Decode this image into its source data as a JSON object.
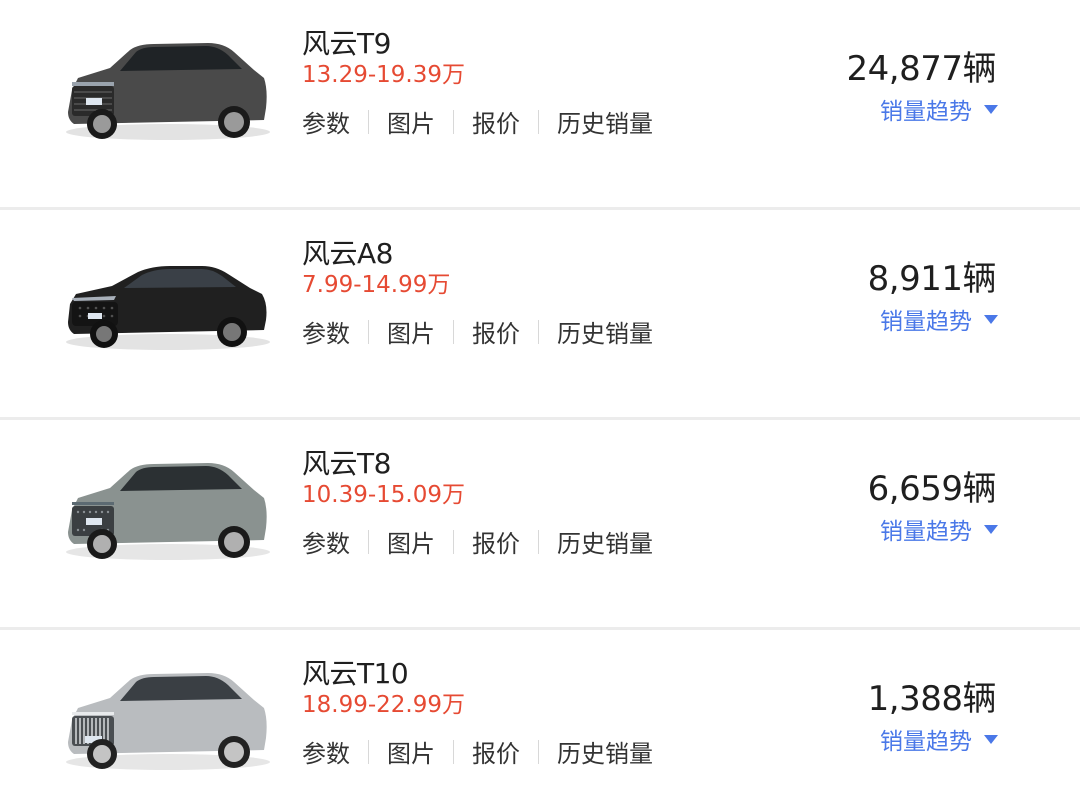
{
  "links": {
    "params": "参数",
    "photos": "图片",
    "quote": "报价",
    "history": "历史销量"
  },
  "trend_label": "销量趋势",
  "cars": [
    {
      "name": "风云T9",
      "price": "13.29-19.39万",
      "sales": "24,877辆",
      "body_color": "#4a4a4a",
      "type": "suv"
    },
    {
      "name": "风云A8",
      "price": "7.99-14.99万",
      "sales": "8,911辆",
      "body_color": "#202020",
      "type": "sedan"
    },
    {
      "name": "风云T8",
      "price": "10.39-15.09万",
      "sales": "6,659辆",
      "body_color": "#8a9290",
      "type": "suv"
    },
    {
      "name": "风云T10",
      "price": "18.99-22.99万",
      "sales": "1,388辆",
      "body_color": "#b9bcbf",
      "type": "suv"
    }
  ],
  "colors": {
    "price": "#e64a33",
    "trend": "#4a78e8",
    "divider": "#ececec"
  }
}
